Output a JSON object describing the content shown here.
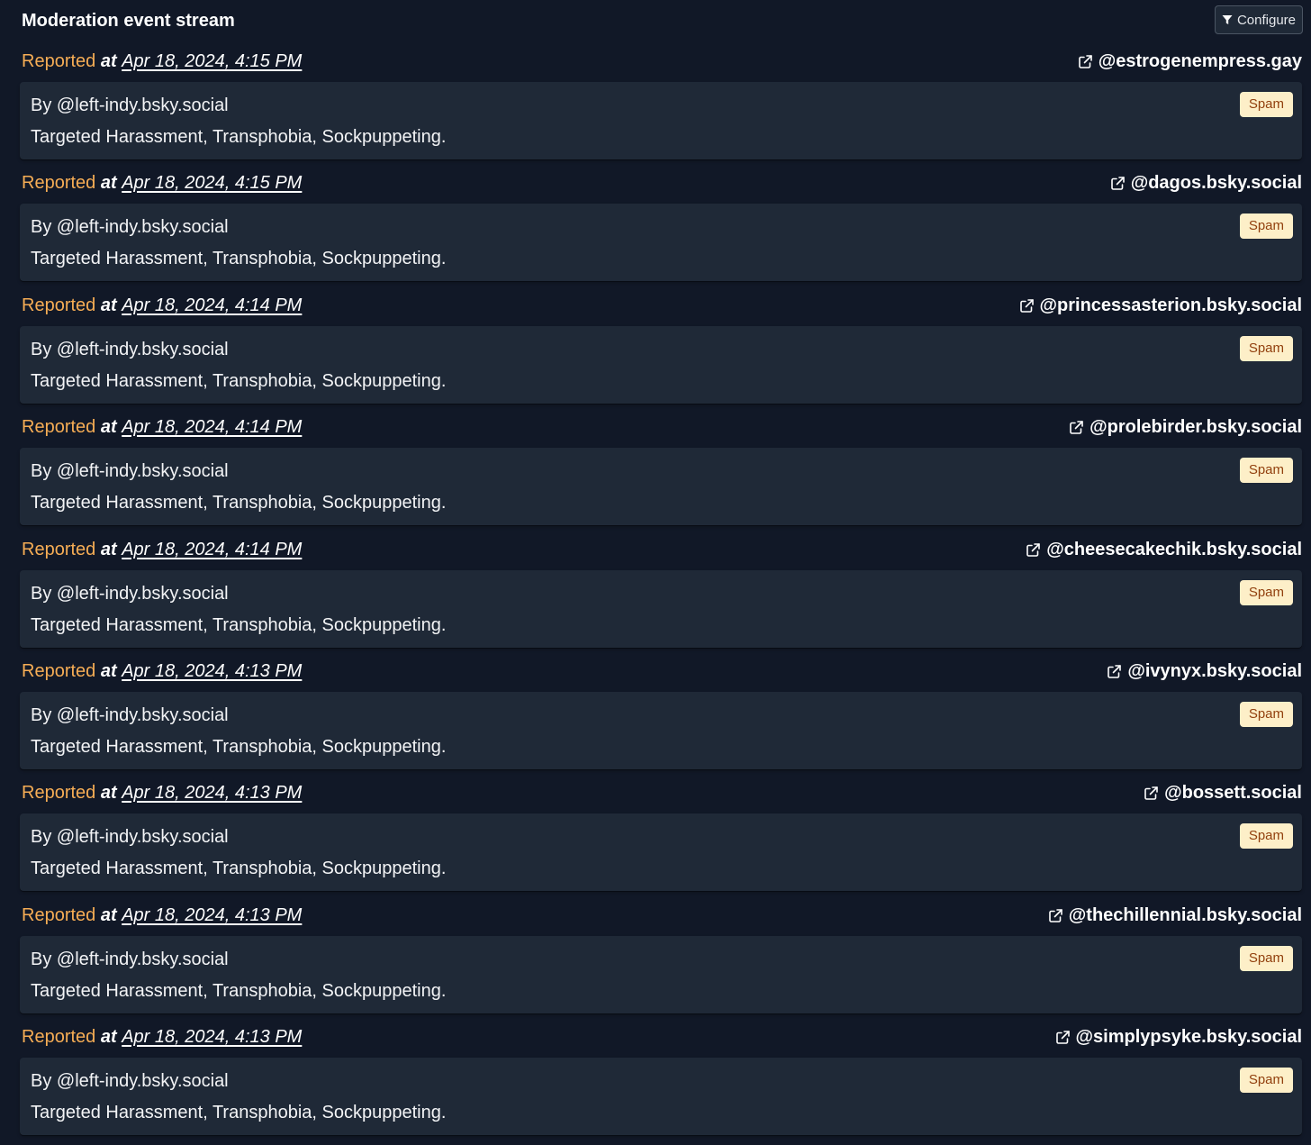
{
  "header": {
    "title": "Moderation event stream",
    "configure_label": "Configure"
  },
  "colors": {
    "background": "#111827",
    "card": "#1f2937",
    "reported_accent": "#f6ad55",
    "badge_bg": "#fdefc8",
    "badge_text": "#92400e"
  },
  "labels": {
    "reported": "Reported",
    "at": "at"
  },
  "events": [
    {
      "time": "Apr 18, 2024, 4:15 PM",
      "subject": "@estrogenempress.gay",
      "reporter": "By @left-indy.bsky.social",
      "reason": "Targeted Harassment, Transphobia, Sockpuppeting.",
      "badge": "Spam"
    },
    {
      "time": "Apr 18, 2024, 4:15 PM",
      "subject": "@dagos.bsky.social",
      "reporter": "By @left-indy.bsky.social",
      "reason": "Targeted Harassment, Transphobia, Sockpuppeting.",
      "badge": "Spam"
    },
    {
      "time": "Apr 18, 2024, 4:14 PM",
      "subject": "@princessasterion.bsky.social",
      "reporter": "By @left-indy.bsky.social",
      "reason": "Targeted Harassment, Transphobia, Sockpuppeting.",
      "badge": "Spam"
    },
    {
      "time": "Apr 18, 2024, 4:14 PM",
      "subject": "@prolebirder.bsky.social",
      "reporter": "By @left-indy.bsky.social",
      "reason": "Targeted Harassment, Transphobia, Sockpuppeting.",
      "badge": "Spam"
    },
    {
      "time": "Apr 18, 2024, 4:14 PM",
      "subject": "@cheesecakechik.bsky.social",
      "reporter": "By @left-indy.bsky.social",
      "reason": "Targeted Harassment, Transphobia, Sockpuppeting.",
      "badge": "Spam"
    },
    {
      "time": "Apr 18, 2024, 4:13 PM",
      "subject": "@ivynyx.bsky.social",
      "reporter": "By @left-indy.bsky.social",
      "reason": "Targeted Harassment, Transphobia, Sockpuppeting.",
      "badge": "Spam"
    },
    {
      "time": "Apr 18, 2024, 4:13 PM",
      "subject": "@bossett.social",
      "reporter": "By @left-indy.bsky.social",
      "reason": "Targeted Harassment, Transphobia, Sockpuppeting.",
      "badge": "Spam"
    },
    {
      "time": "Apr 18, 2024, 4:13 PM",
      "subject": "@thechillennial.bsky.social",
      "reporter": "By @left-indy.bsky.social",
      "reason": "Targeted Harassment, Transphobia, Sockpuppeting.",
      "badge": "Spam"
    },
    {
      "time": "Apr 18, 2024, 4:13 PM",
      "subject": "@simplypsyke.bsky.social",
      "reporter": "By @left-indy.bsky.social",
      "reason": "Targeted Harassment, Transphobia, Sockpuppeting.",
      "badge": "Spam"
    }
  ]
}
